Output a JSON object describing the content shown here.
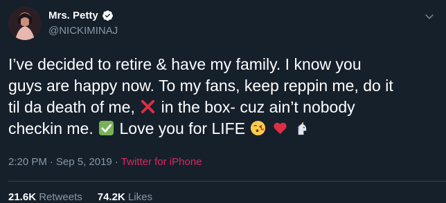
{
  "user": {
    "name": "Mrs. Petty",
    "handle": "@NICKIMINAJ"
  },
  "tweet": {
    "line1": "I’ve decided to retire & have my family. I know you",
    "line2": "guys are happy now. To my fans, keep reppin me, do it",
    "line3_a": "til da death of me,",
    "line3_b": "in the box- cuz ain’t nobody",
    "line4_a": "checkin me.",
    "line4_b": "Love you for LIFE",
    "emojis": [
      "cross-mark-emoji",
      "check-mark-button-emoji",
      "face-blowing-kiss-emoji",
      "red-heart-emoji",
      "unicorn-emoji"
    ]
  },
  "meta": {
    "time": "2:20 PM",
    "sep1": "·",
    "date": "Sep 5, 2019",
    "sep2": "·",
    "source": "Twitter for iPhone"
  },
  "stats": {
    "retweets_count": "21.6K",
    "retweets_label": "Retweets",
    "likes_count": "74.2K",
    "likes_label": "Likes"
  },
  "colors": {
    "background": "#15202b",
    "secondary_text": "#8899a6",
    "source_link": "#e0245e",
    "verified": "#ffffff"
  }
}
